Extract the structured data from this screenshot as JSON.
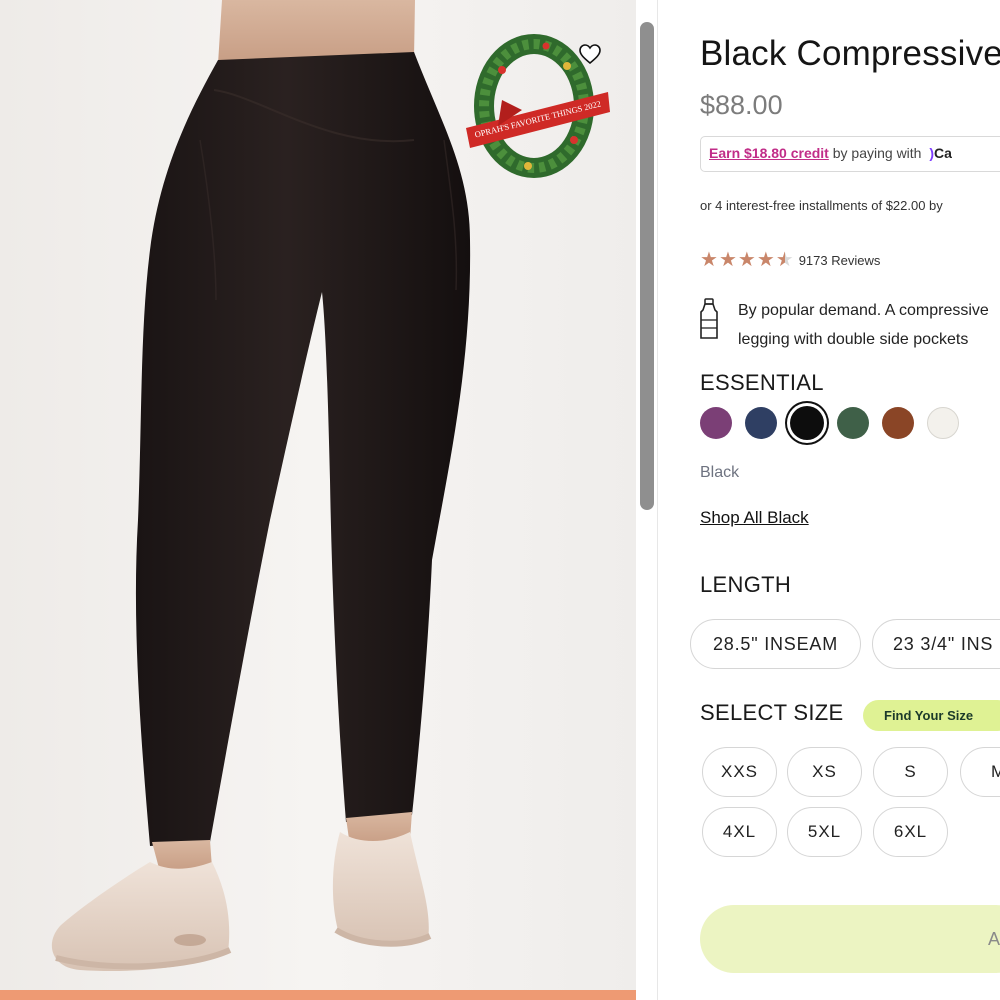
{
  "product": {
    "title": "Black Compressive Legging",
    "price": "$88.00",
    "credit": {
      "link_text": "Earn $18.80 credit",
      "suffix": " by paying with",
      "brand": "Ca"
    },
    "installments": "or 4 interest-free installments of $22.00 by",
    "rating": {
      "stars": 4.5,
      "reviews": "9173 Reviews"
    },
    "description": {
      "line1": "By popular demand. A compressive",
      "line2": "legging with double side pockets"
    }
  },
  "gallery": {
    "badge_text": "OPRAH'S FAVORITE THINGS 2022"
  },
  "collection": {
    "label": "ESSENTIAL",
    "swatches": [
      {
        "name": "plum",
        "color": "#7b3f76"
      },
      {
        "name": "navy",
        "color": "#2f3f63"
      },
      {
        "name": "black",
        "color": "#0d0d0d",
        "selected": true
      },
      {
        "name": "green",
        "color": "#3f6048"
      },
      {
        "name": "brown",
        "color": "#8a4526"
      },
      {
        "name": "ivory",
        "color": "#f3f1ec"
      }
    ],
    "selected_color": "Black",
    "shop_all": "Shop All Black"
  },
  "length": {
    "label": "LENGTH",
    "options": [
      "28.5\" INSEAM",
      "23 3/4\" INS"
    ]
  },
  "size": {
    "label": "SELECT SIZE",
    "find_label": "Find Your Size",
    "row1": [
      "XXS",
      "XS",
      "S",
      "M"
    ],
    "row2": [
      "4XL",
      "5XL",
      "6XL"
    ]
  },
  "cta": {
    "label": "A"
  },
  "colors": {
    "accent_pink": "#c12d88",
    "star": "#c9866a",
    "cta_bg": "#ecf4c2",
    "find_size_bg": "#dff294"
  }
}
